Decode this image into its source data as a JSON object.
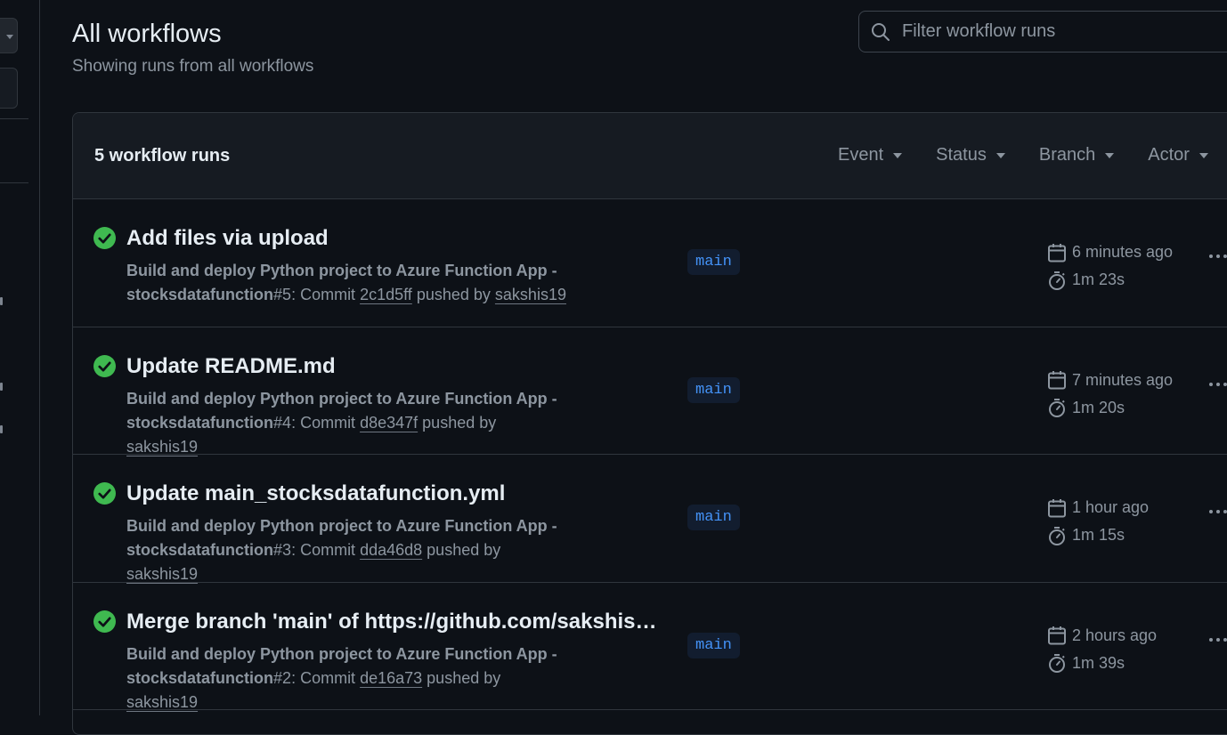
{
  "header": {
    "title": "All workflows",
    "subtitle": "Showing runs from all workflows"
  },
  "search": {
    "placeholder": "Filter workflow runs"
  },
  "list": {
    "count_label": "5 workflow runs",
    "filters": [
      {
        "label": "Event"
      },
      {
        "label": "Status"
      },
      {
        "label": "Branch"
      },
      {
        "label": "Actor"
      }
    ],
    "runs": [
      {
        "title": "Add files via upload",
        "workflow_line": "Build and deploy Python project to Azure Function App -",
        "workflow_name": "stocksdatafunction",
        "run_number": "#5",
        "commit_prefix": ": Commit",
        "commit": "2c1d5ff",
        "pushed_by": "pushed by",
        "actor": "sakshis19",
        "branch": "main",
        "time": "6 minutes ago",
        "duration": "1m 23s",
        "status": "success"
      },
      {
        "title": "Update README.md",
        "workflow_line": "Build and deploy Python project to Azure Function App -",
        "workflow_name": "stocksdatafunction",
        "run_number": "#4",
        "commit_prefix": ": Commit",
        "commit": "d8e347f",
        "pushed_by": "pushed by",
        "actor": "sakshis19",
        "branch": "main",
        "time": "7 minutes ago",
        "duration": "1m 20s",
        "status": "success"
      },
      {
        "title": "Update main_stocksdatafunction.yml",
        "workflow_line": "Build and deploy Python project to Azure Function App -",
        "workflow_name": "stocksdatafunction",
        "run_number": "#3",
        "commit_prefix": ": Commit",
        "commit": "dda46d8",
        "pushed_by": "pushed by",
        "actor": "sakshis19",
        "branch": "main",
        "time": "1 hour ago",
        "duration": "1m 15s",
        "status": "success"
      },
      {
        "title": "Merge branch 'main' of https://github.com/sakshis19...",
        "workflow_line": "Build and deploy Python project to Azure Function App -",
        "workflow_name": "stocksdatafunction",
        "run_number": "#2",
        "commit_prefix": ": Commit",
        "commit": "de16a73",
        "pushed_by": "pushed by",
        "actor": "sakshis19",
        "branch": "main",
        "time": "2 hours ago",
        "duration": "1m 39s",
        "status": "success"
      }
    ]
  },
  "colors": {
    "background": "#0d1117",
    "success": "#3fb950",
    "branch_text": "#4493f8",
    "muted": "#8d96a0"
  },
  "icons": {
    "search": "search-icon",
    "status": "check-circle-icon",
    "calendar": "calendar-icon",
    "duration": "stopwatch-icon",
    "more": "kebab-horizontal-icon"
  }
}
